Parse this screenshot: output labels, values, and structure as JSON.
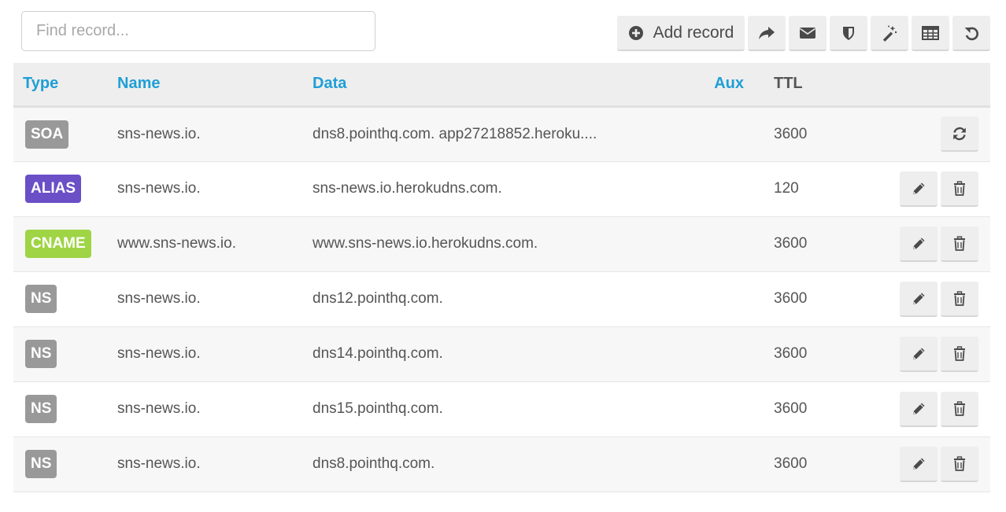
{
  "search": {
    "placeholder": "Find record..."
  },
  "toolbar": {
    "add_label": "Add record",
    "buttons": [
      {
        "icon": "plus-circle-icon"
      },
      {
        "icon": "share-icon"
      },
      {
        "icon": "envelope-icon"
      },
      {
        "icon": "shield-icon"
      },
      {
        "icon": "magic-wand-icon"
      },
      {
        "icon": "table-icon"
      },
      {
        "icon": "undo-icon"
      }
    ]
  },
  "table": {
    "headers": {
      "type": "Type",
      "name": "Name",
      "data": "Data",
      "aux": "Aux",
      "ttl": "TTL"
    },
    "rows": [
      {
        "type": "SOA",
        "type_color": "#999999",
        "name": "sns-news.io.",
        "data": "dns8.pointhq.com. app27218852.heroku....",
        "aux": "",
        "ttl": "3600",
        "actions": [
          "refresh-icon"
        ]
      },
      {
        "type": "ALIAS",
        "type_color": "#6a4fc7",
        "name": "sns-news.io.",
        "data": "sns-news.io.herokudns.com.",
        "aux": "",
        "ttl": "120",
        "actions": [
          "pencil-icon",
          "trash-icon"
        ]
      },
      {
        "type": "CNAME",
        "type_color": "#9fd444",
        "name": "www.sns-news.io.",
        "data": "www.sns-news.io.herokudns.com.",
        "aux": "",
        "ttl": "3600",
        "actions": [
          "pencil-icon",
          "trash-icon"
        ]
      },
      {
        "type": "NS",
        "type_color": "#999999",
        "name": "sns-news.io.",
        "data": "dns12.pointhq.com.",
        "aux": "",
        "ttl": "3600",
        "actions": [
          "pencil-icon",
          "trash-icon"
        ]
      },
      {
        "type": "NS",
        "type_color": "#999999",
        "name": "sns-news.io.",
        "data": "dns14.pointhq.com.",
        "aux": "",
        "ttl": "3600",
        "actions": [
          "pencil-icon",
          "trash-icon"
        ]
      },
      {
        "type": "NS",
        "type_color": "#999999",
        "name": "sns-news.io.",
        "data": "dns15.pointhq.com.",
        "aux": "",
        "ttl": "3600",
        "actions": [
          "pencil-icon",
          "trash-icon"
        ]
      },
      {
        "type": "NS",
        "type_color": "#999999",
        "name": "sns-news.io.",
        "data": "dns8.pointhq.com.",
        "aux": "",
        "ttl": "3600",
        "actions": [
          "pencil-icon",
          "trash-icon"
        ]
      }
    ]
  },
  "colors": {
    "header_link": "#1f9fd6",
    "button_bg": "#eeeeee"
  }
}
